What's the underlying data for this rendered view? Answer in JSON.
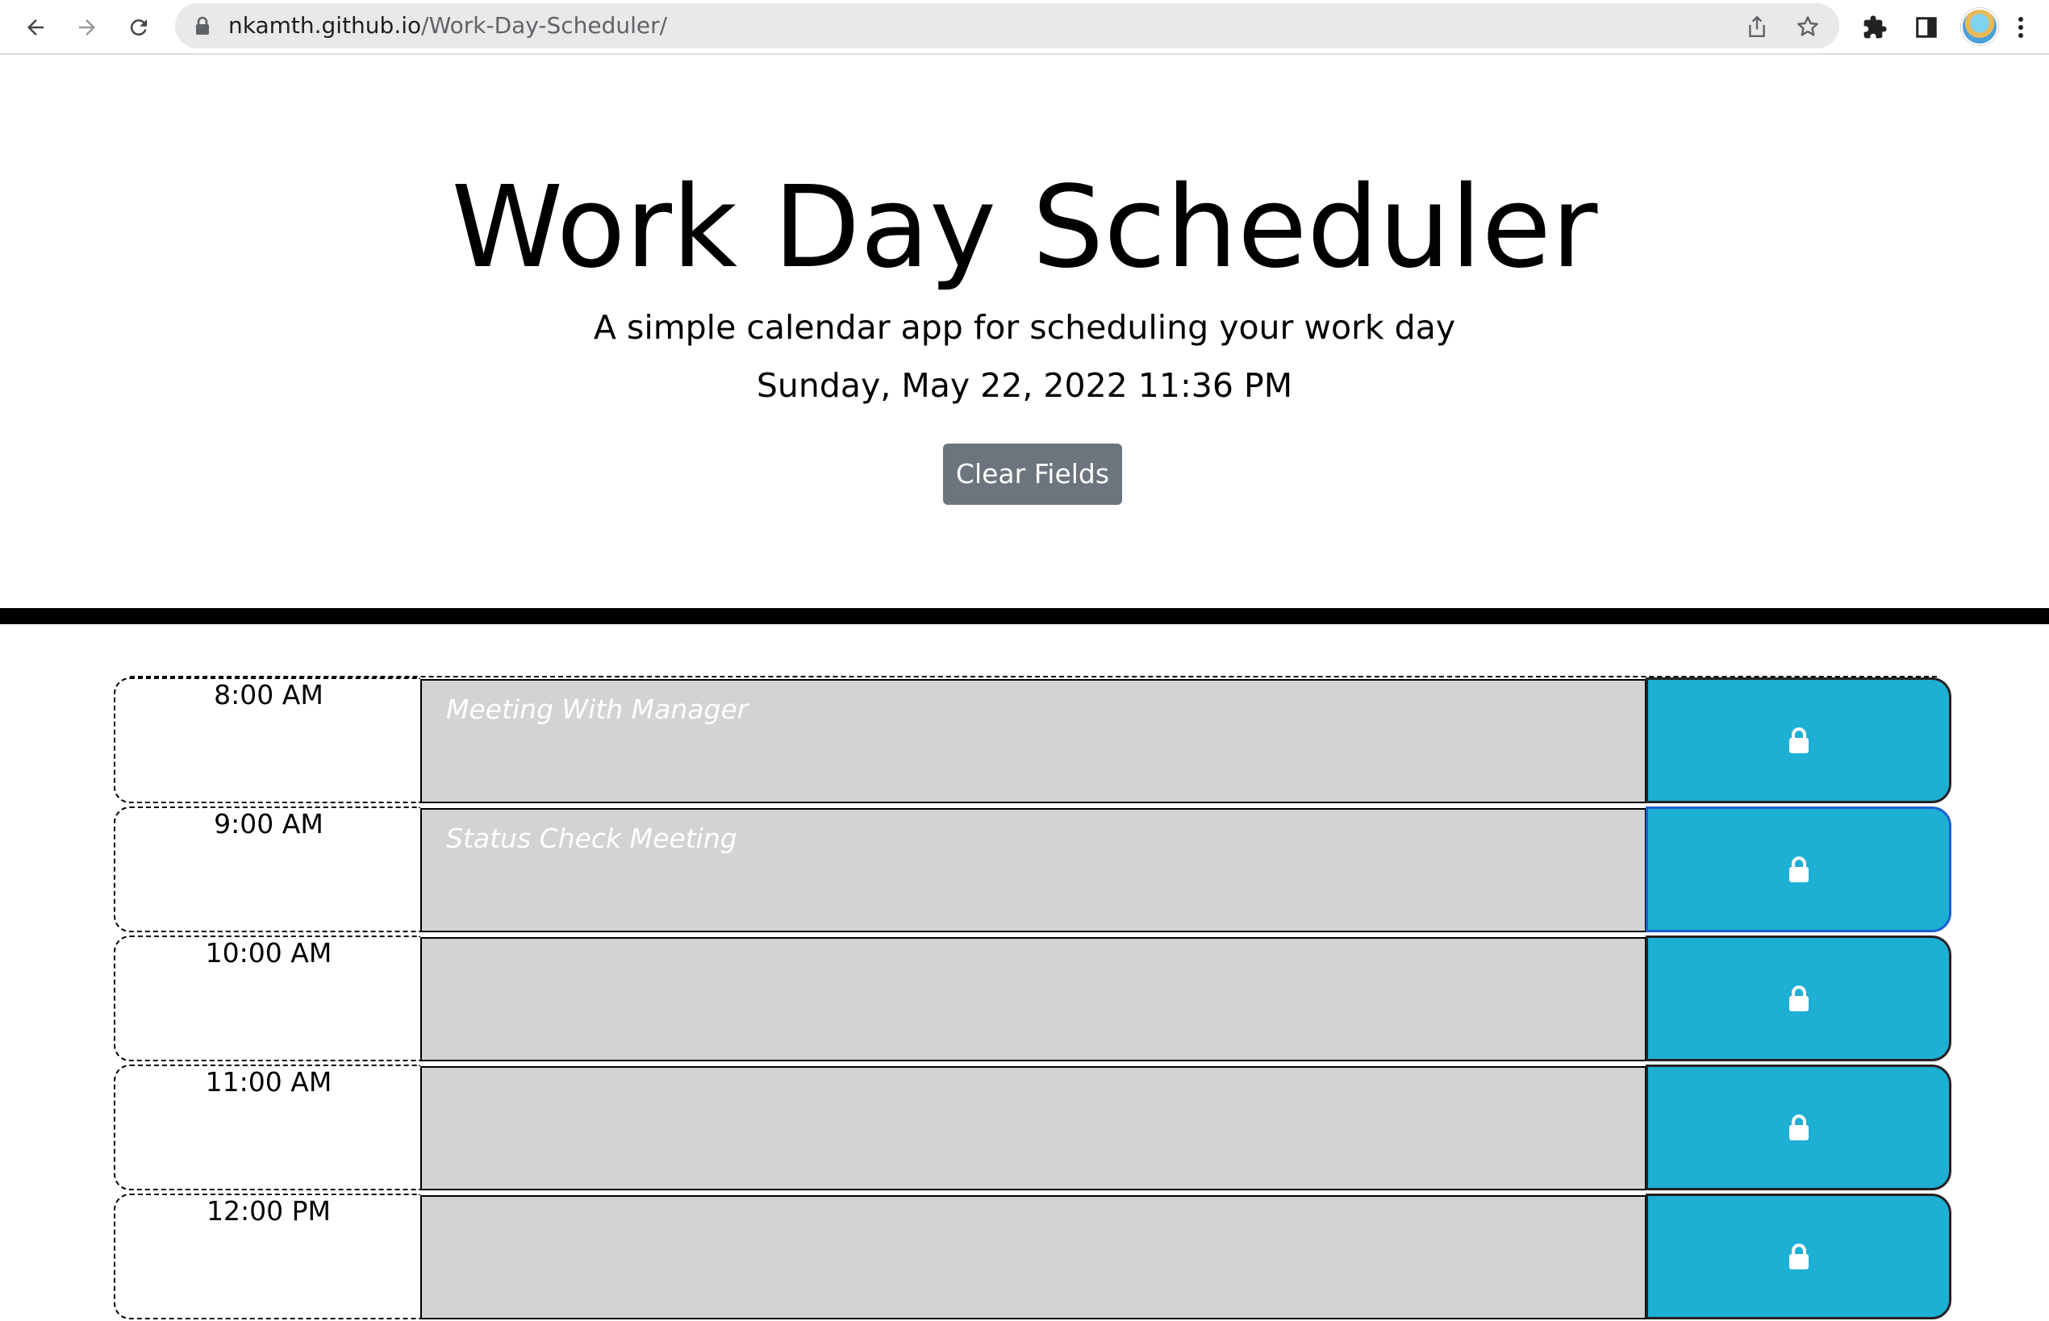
{
  "browser": {
    "url_domain": "nkamth.github.io",
    "url_path": "/Work-Day-Scheduler/",
    "icons": [
      "back-icon",
      "forward-icon",
      "reload-icon",
      "lock-icon",
      "share-icon",
      "bookmark-star-icon",
      "extensions-icon",
      "side-panel-icon",
      "profile-avatar",
      "more-menu-icon"
    ]
  },
  "header": {
    "title": "Work Day Scheduler",
    "lead": "A simple calendar app for scheduling your work day",
    "current_day": "Sunday, May 22, 2022 11:36 PM",
    "clear_label": "Clear Fields"
  },
  "colors": {
    "past_block": "#d3d3d3",
    "save_button": "#1eafd4",
    "clear_button": "#6c757d"
  },
  "time_blocks": [
    {
      "hour": "8:00 AM",
      "text": "Meeting With Manager"
    },
    {
      "hour": "9:00 AM",
      "text": "Status Check Meeting"
    },
    {
      "hour": "10:00 AM",
      "text": ""
    },
    {
      "hour": "11:00 AM",
      "text": ""
    },
    {
      "hour": "12:00 PM",
      "text": ""
    }
  ]
}
